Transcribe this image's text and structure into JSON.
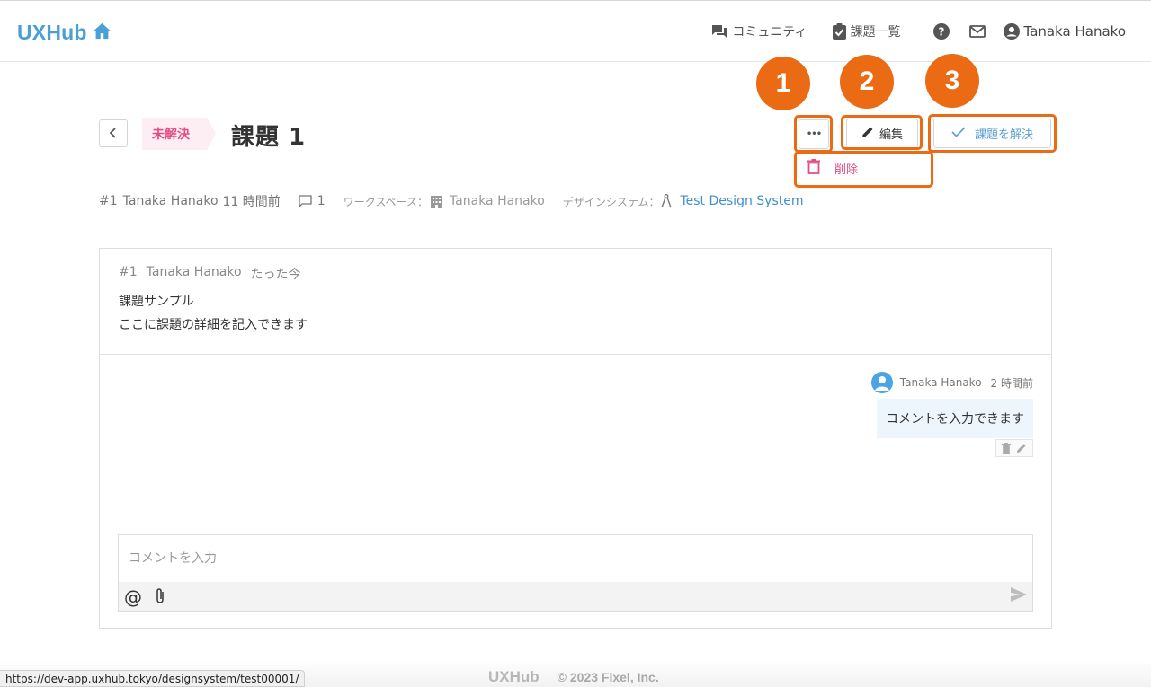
{
  "header": {
    "logo": "UXHub",
    "nav": {
      "community": "コミュニティ",
      "issues": "課題一覧",
      "user": "Tanaka Hanako"
    }
  },
  "issue": {
    "status": "未解決",
    "title": "課題 1",
    "actions": {
      "more": "•••",
      "edit": "編集",
      "resolve": "課題を解決",
      "delete": "削除"
    },
    "meta": {
      "number": "#1",
      "author": "Tanaka Hanako",
      "time": "11 時間前",
      "comment_count": "1",
      "workspace_label": "ワークスペース：",
      "workspace": "Tanaka Hanako",
      "ds_label": "デザインシステム：",
      "design_system": "Test Design System"
    },
    "post": {
      "number": "#1",
      "author": "Tanaka Hanako",
      "time": "たった今",
      "line1": "課題サンプル",
      "line2": "ここに課題の詳細を記入できます"
    },
    "comment": {
      "author": "Tanaka Hanako",
      "time": "2 時間前",
      "text": "コメントを入力できます"
    },
    "composer": {
      "placeholder": "コメントを入力",
      "at": "@"
    }
  },
  "callouts": [
    "1",
    "2",
    "3"
  ],
  "footer": {
    "logo": "UXHub",
    "copyright": "© 2023 Fixel, Inc."
  },
  "status_bar": {
    "url": "https://dev-app.uxhub.tokyo/designsystem/test00001/"
  },
  "colors": {
    "brand": "#4a9fd6",
    "unresolved": "#e24d85",
    "callout": "#ea6b14",
    "link": "#3f8fc9"
  }
}
